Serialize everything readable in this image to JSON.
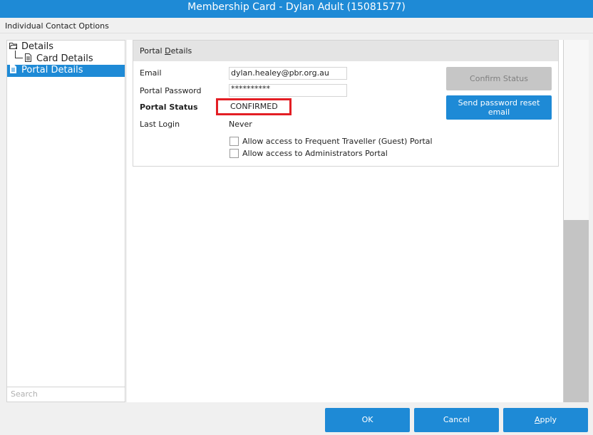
{
  "window": {
    "title": "Membership Card - Dylan Adult (15081577)"
  },
  "toolbar": {
    "label": "Individual Contact Options"
  },
  "tree": {
    "items": [
      {
        "label": "Details",
        "icon": "folder-open-icon"
      },
      {
        "label": "Card Details",
        "icon": "document-icon"
      },
      {
        "label": "Portal Details",
        "icon": "document-icon",
        "selected": true
      }
    ],
    "search_placeholder": "Search"
  },
  "portal": {
    "group_title_prefix": "Portal ",
    "group_title_underlined": "D",
    "group_title_suffix": "etails",
    "email_label": "Email",
    "email_value": "dylan.healey@pbr.org.au",
    "password_label": "Portal Password",
    "password_value": "**********",
    "status_label": "Portal Status",
    "status_value": "CONFIRMED",
    "last_login_label": "Last Login",
    "last_login_value": "Never",
    "allow_guest_label": "Allow access to Frequent Traveller (Guest) Portal",
    "allow_admin_label": "Allow access to Administrators Portal",
    "confirm_status_label": "Confirm Status",
    "send_reset_label_line1": "Send password reset",
    "send_reset_label_line2": "email"
  },
  "footer": {
    "ok_label": "OK",
    "cancel_label": "Cancel",
    "apply_prefix": "",
    "apply_underlined": "A",
    "apply_suffix": "pply"
  },
  "colors": {
    "accent": "#1e8ad6",
    "highlight": "#e31e24"
  }
}
